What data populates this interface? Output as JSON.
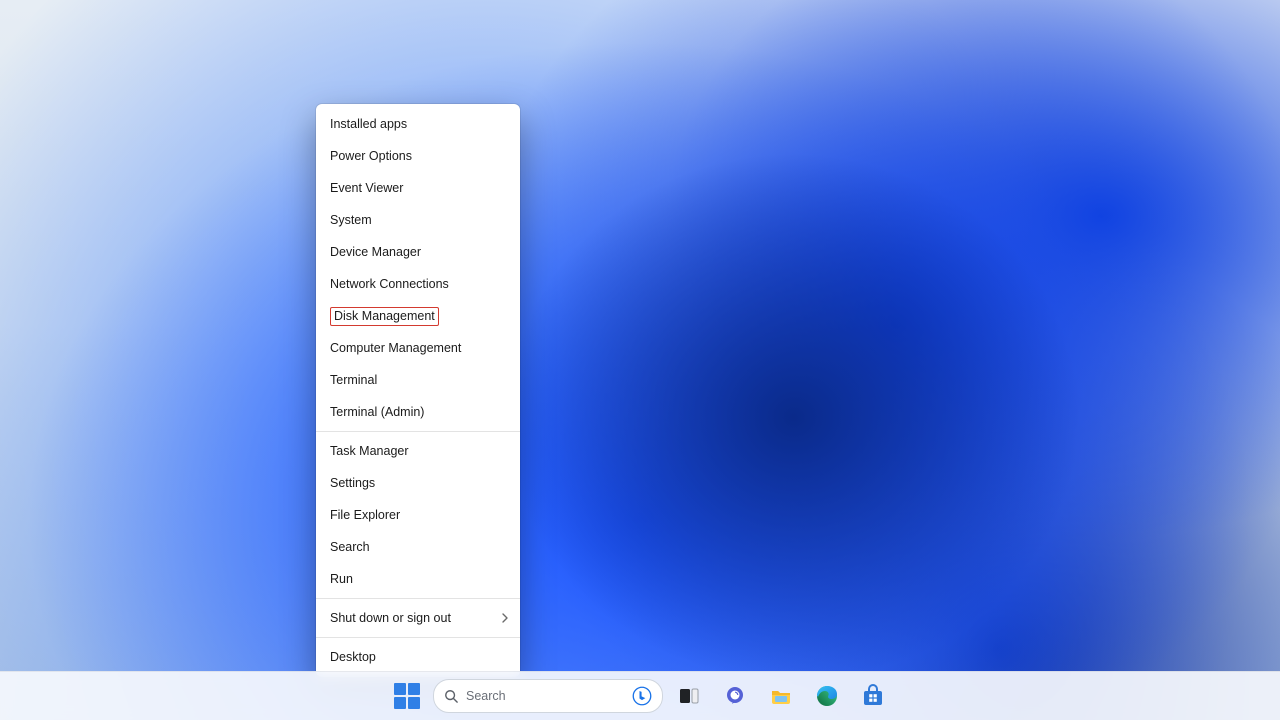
{
  "context_menu": {
    "groups": [
      [
        {
          "id": "installed-apps",
          "label": "Installed apps"
        },
        {
          "id": "power-options",
          "label": "Power Options"
        },
        {
          "id": "event-viewer",
          "label": "Event Viewer"
        },
        {
          "id": "system",
          "label": "System"
        },
        {
          "id": "device-manager",
          "label": "Device Manager"
        },
        {
          "id": "network-connections",
          "label": "Network Connections"
        },
        {
          "id": "disk-management",
          "label": "Disk Management",
          "highlighted": true
        },
        {
          "id": "computer-management",
          "label": "Computer Management"
        },
        {
          "id": "terminal",
          "label": "Terminal"
        },
        {
          "id": "terminal-admin",
          "label": "Terminal (Admin)"
        }
      ],
      [
        {
          "id": "task-manager",
          "label": "Task Manager"
        },
        {
          "id": "settings",
          "label": "Settings"
        },
        {
          "id": "file-explorer",
          "label": "File Explorer"
        },
        {
          "id": "search",
          "label": "Search"
        },
        {
          "id": "run",
          "label": "Run"
        }
      ],
      [
        {
          "id": "shut-down",
          "label": "Shut down or sign out",
          "submenu": true
        }
      ],
      [
        {
          "id": "desktop",
          "label": "Desktop"
        }
      ]
    ]
  },
  "taskbar": {
    "search_placeholder": "Search",
    "apps": [
      {
        "id": "start",
        "name": "Start"
      },
      {
        "id": "search",
        "name": "Search"
      },
      {
        "id": "taskview",
        "name": "Task View"
      },
      {
        "id": "chat",
        "name": "Chat"
      },
      {
        "id": "explorer",
        "name": "File Explorer"
      },
      {
        "id": "edge",
        "name": "Microsoft Edge"
      },
      {
        "id": "store",
        "name": "Microsoft Store"
      }
    ]
  },
  "colors": {
    "highlight_border": "#d33a2f",
    "win_blue": "#2f7fe6"
  }
}
